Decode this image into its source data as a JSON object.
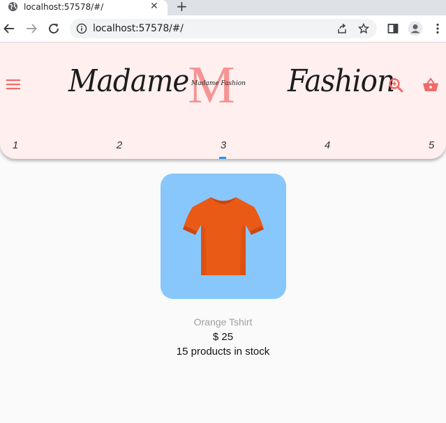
{
  "browser": {
    "tab_title": "localhost:57578/#/",
    "tab_close": "✕",
    "new_tab": "+",
    "url": "localhost:57578/#/"
  },
  "header": {
    "brand_left": "Madame",
    "brand_right": "Fashion",
    "logo_letter": "M",
    "logo_signature": "Madame Fashion",
    "accent_color": "#f06a6a",
    "background_color": "#ffefef"
  },
  "tabs": [
    {
      "label": "1"
    },
    {
      "label": "2"
    },
    {
      "label": "3"
    },
    {
      "label": "4"
    },
    {
      "label": "5"
    }
  ],
  "selected_tab": "3",
  "product": {
    "image_icon": "orange-tshirt-image",
    "name": "Orange Tshirt",
    "price": "$ 25",
    "stock": "15 products in stock",
    "image_background": "#87c7fc"
  }
}
